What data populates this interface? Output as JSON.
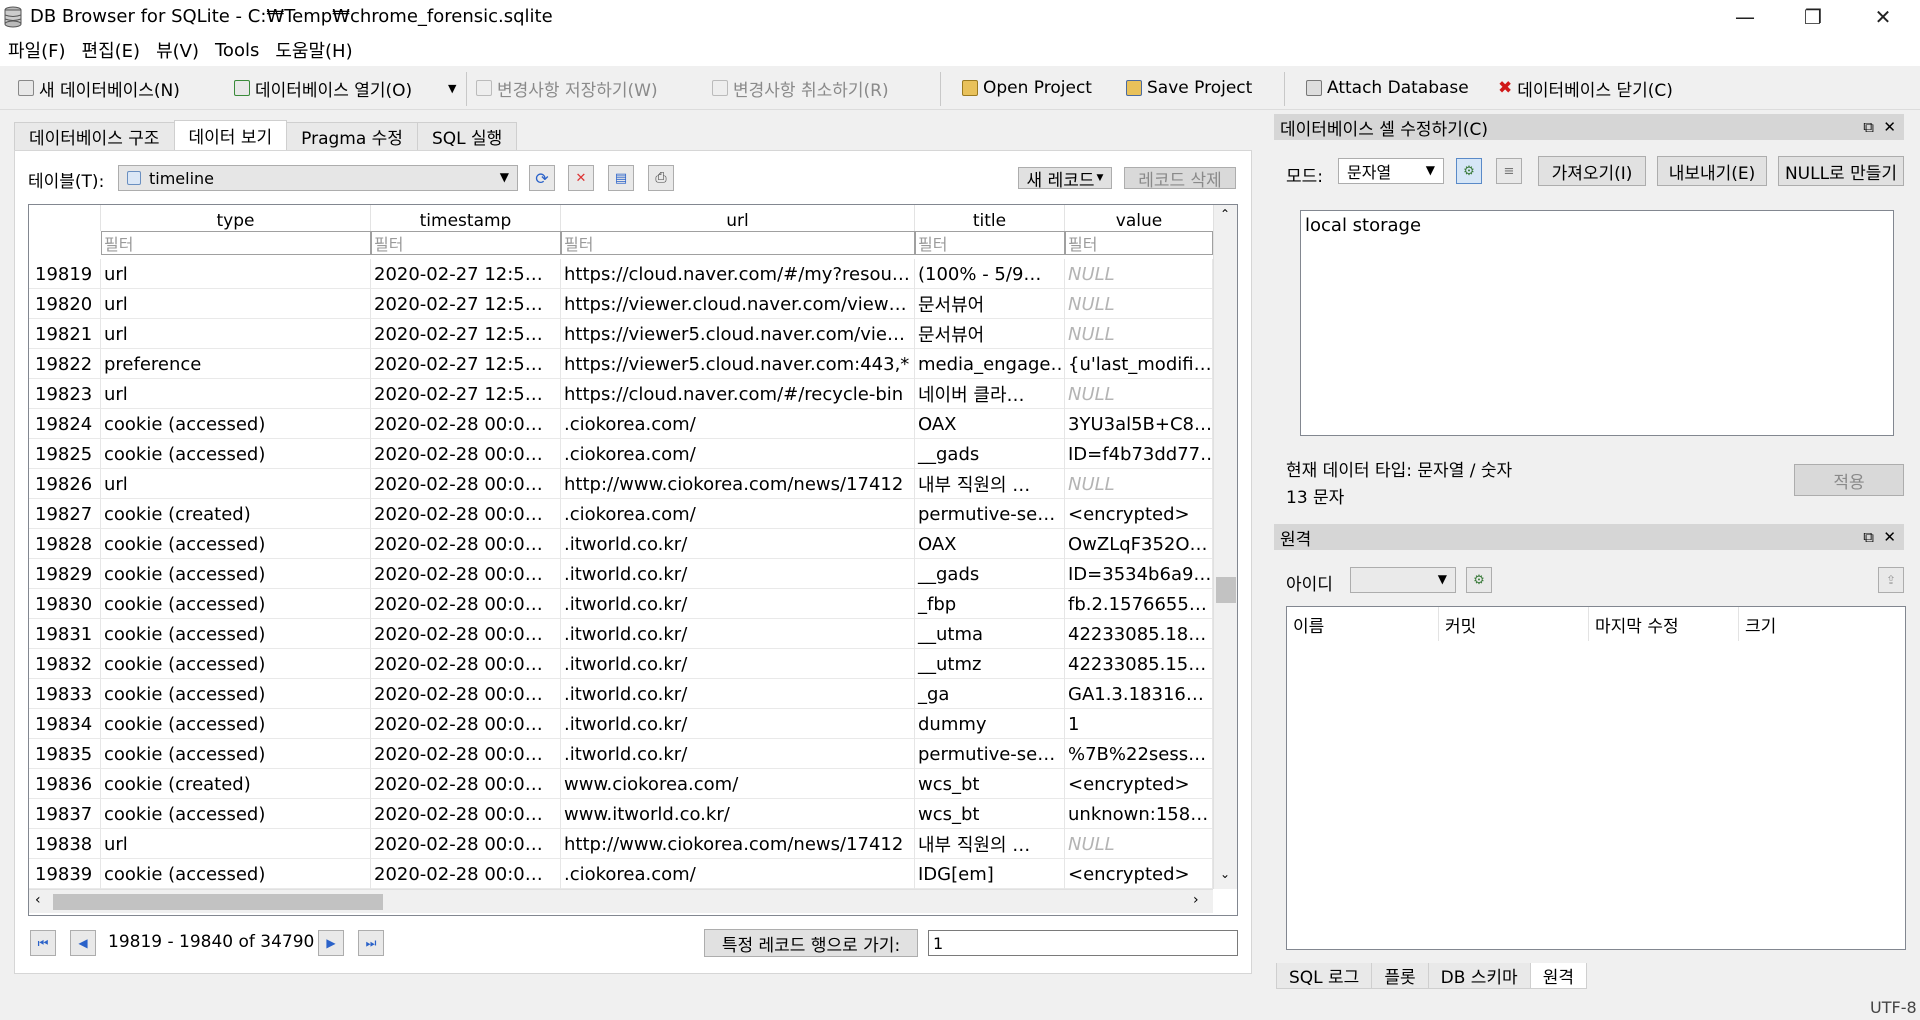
{
  "window": {
    "title": "DB Browser for SQLite - C:₩Temp₩chrome_forensic.sqlite",
    "minimize": "—",
    "maximize": "❐",
    "close": "✕"
  },
  "menu": [
    "파일(F)",
    "편집(E)",
    "뷰(V)",
    "Tools",
    "도움말(H)"
  ],
  "toolbar": {
    "new_db": "새 데이터베이스(N)",
    "open_db": "데이터베이스 열기(O)",
    "write_changes": "변경사항 저장하기(W)",
    "revert_changes": "변경사항 취소하기(R)",
    "open_project": "Open Project",
    "save_project": "Save Project",
    "attach_db": "Attach Database",
    "close_db": "데이터베이스 닫기(C)"
  },
  "tabs": [
    "데이터베이스 구조",
    "데이터 보기",
    "Pragma 수정",
    "SQL 실행"
  ],
  "browse": {
    "table_label": "테이블(T):",
    "table_value": "timeline",
    "new_record": "새 레코드",
    "delete_record": "레코드 삭제",
    "filter_placeholder": "필터",
    "columns": [
      "type",
      "timestamp",
      "url",
      "title",
      "value"
    ],
    "rows": [
      {
        "id": "19819",
        "type": "url",
        "timestamp": "2020-02-27 12:5…",
        "url": "https://cloud.naver.com/#/my?resou…",
        "title": "(100% - 5/9…",
        "value": "NULL"
      },
      {
        "id": "19820",
        "type": "url",
        "timestamp": "2020-02-27 12:5…",
        "url": "https://viewer.cloud.naver.com/view…",
        "title": "문서뷰어",
        "value": "NULL"
      },
      {
        "id": "19821",
        "type": "url",
        "timestamp": "2020-02-27 12:5…",
        "url": "https://viewer5.cloud.naver.com/vie…",
        "title": "문서뷰어",
        "value": "NULL"
      },
      {
        "id": "19822",
        "type": "preference",
        "timestamp": "2020-02-27 12:5…",
        "url": "https://viewer5.cloud.naver.com:443,*",
        "title": "media_engage…",
        "value": "{u'last_modifi…"
      },
      {
        "id": "19823",
        "type": "url",
        "timestamp": "2020-02-27 12:5…",
        "url": "https://cloud.naver.com/#/recycle-bin",
        "title": "네이버 클라…",
        "value": "NULL"
      },
      {
        "id": "19824",
        "type": "cookie (accessed)",
        "timestamp": "2020-02-28 00:0…",
        "url": ".ciokorea.com/",
        "title": "OAX",
        "value": "3YU3al5B+C8…"
      },
      {
        "id": "19825",
        "type": "cookie (accessed)",
        "timestamp": "2020-02-28 00:0…",
        "url": ".ciokorea.com/",
        "title": "__gads",
        "value": "ID=f4b73dd77…"
      },
      {
        "id": "19826",
        "type": "url",
        "timestamp": "2020-02-28 00:0…",
        "url": "http://www.ciokorea.com/news/17412",
        "title": "내부 직원의 …",
        "value": "NULL"
      },
      {
        "id": "19827",
        "type": "cookie (created)",
        "timestamp": "2020-02-28 00:0…",
        "url": ".ciokorea.com/",
        "title": "permutive-se…",
        "value": "<encrypted>"
      },
      {
        "id": "19828",
        "type": "cookie (accessed)",
        "timestamp": "2020-02-28 00:0…",
        "url": ".itworld.co.kr/",
        "title": "OAX",
        "value": "OwZLqF352O…"
      },
      {
        "id": "19829",
        "type": "cookie (accessed)",
        "timestamp": "2020-02-28 00:0…",
        "url": ".itworld.co.kr/",
        "title": "__gads",
        "value": "ID=3534b6a9…"
      },
      {
        "id": "19830",
        "type": "cookie (accessed)",
        "timestamp": "2020-02-28 00:0…",
        "url": ".itworld.co.kr/",
        "title": "_fbp",
        "value": "fb.2.1576655…"
      },
      {
        "id": "19831",
        "type": "cookie (accessed)",
        "timestamp": "2020-02-28 00:0…",
        "url": ".itworld.co.kr/",
        "title": "__utma",
        "value": "42233085.18…"
      },
      {
        "id": "19832",
        "type": "cookie (accessed)",
        "timestamp": "2020-02-28 00:0…",
        "url": ".itworld.co.kr/",
        "title": "__utmz",
        "value": "42233085.15…"
      },
      {
        "id": "19833",
        "type": "cookie (accessed)",
        "timestamp": "2020-02-28 00:0…",
        "url": ".itworld.co.kr/",
        "title": "_ga",
        "value": "GA1.3.18316…"
      },
      {
        "id": "19834",
        "type": "cookie (accessed)",
        "timestamp": "2020-02-28 00:0…",
        "url": ".itworld.co.kr/",
        "title": "dummy",
        "value": "1"
      },
      {
        "id": "19835",
        "type": "cookie (accessed)",
        "timestamp": "2020-02-28 00:0…",
        "url": ".itworld.co.kr/",
        "title": "permutive-se…",
        "value": "%7B%22sess…"
      },
      {
        "id": "19836",
        "type": "cookie (created)",
        "timestamp": "2020-02-28 00:0…",
        "url": "www.ciokorea.com/",
        "title": "wcs_bt",
        "value": "<encrypted>"
      },
      {
        "id": "19837",
        "type": "cookie (accessed)",
        "timestamp": "2020-02-28 00:0…",
        "url": "www.itworld.co.kr/",
        "title": "wcs_bt",
        "value": "unknown:158…"
      },
      {
        "id": "19838",
        "type": "url",
        "timestamp": "2020-02-28 00:0…",
        "url": "http://www.ciokorea.com/news/17412",
        "title": "내부 직원의 …",
        "value": "NULL"
      },
      {
        "id": "19839",
        "type": "cookie (accessed)",
        "timestamp": "2020-02-28 00:0…",
        "url": ".ciokorea.com/",
        "title": "IDG[em]",
        "value": "<encrypted>"
      }
    ],
    "range_text": "19819 - 19840 of 34790",
    "goto_label": "특정 레코드 행으로 가기:",
    "goto_value": "1"
  },
  "edit_cell": {
    "title": "데이터베이스 셀 수정하기(C)",
    "mode_label": "모드:",
    "mode_value": "문자열",
    "import_btn": "가져오기(I)",
    "export_btn": "내보내기(E)",
    "null_btn": "NULL로 만들기",
    "content": "local storage",
    "type_text": "현재 데이터 타입: 문자열 / 숫자",
    "size_text": "13 문자",
    "apply_btn": "적용"
  },
  "remote": {
    "title": "원격",
    "id_label": "아이디",
    "columns": [
      "이름",
      "커밋",
      "마지막 수정",
      "크기"
    ]
  },
  "bottom_tabs": [
    "SQL 로그",
    "플롯",
    "DB 스키마",
    "원격"
  ],
  "status": {
    "encoding": "UTF-8"
  }
}
